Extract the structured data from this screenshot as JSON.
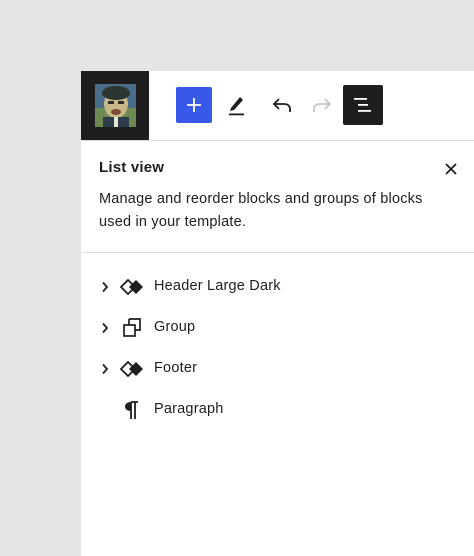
{
  "toolbar": {
    "site_logo_alt": "Site logo",
    "add_button": "plus-icon",
    "edit_button": "pencil-icon",
    "undo_button": "undo-icon",
    "redo_button": "redo-icon",
    "list_view_button": "list-view-icon",
    "accent_color": "#3858e9"
  },
  "panel": {
    "title": "List view",
    "description": "Manage and reorder blocks and groups of blocks used in your template.",
    "close_icon": "close-icon"
  },
  "blocks": [
    {
      "label": "Header Large Dark",
      "icon": "template-part-icon",
      "expandable": true
    },
    {
      "label": "Group",
      "icon": "group-icon",
      "expandable": true
    },
    {
      "label": "Footer",
      "icon": "template-part-icon",
      "expandable": true
    },
    {
      "label": "Paragraph",
      "icon": "paragraph-icon",
      "expandable": false
    }
  ]
}
